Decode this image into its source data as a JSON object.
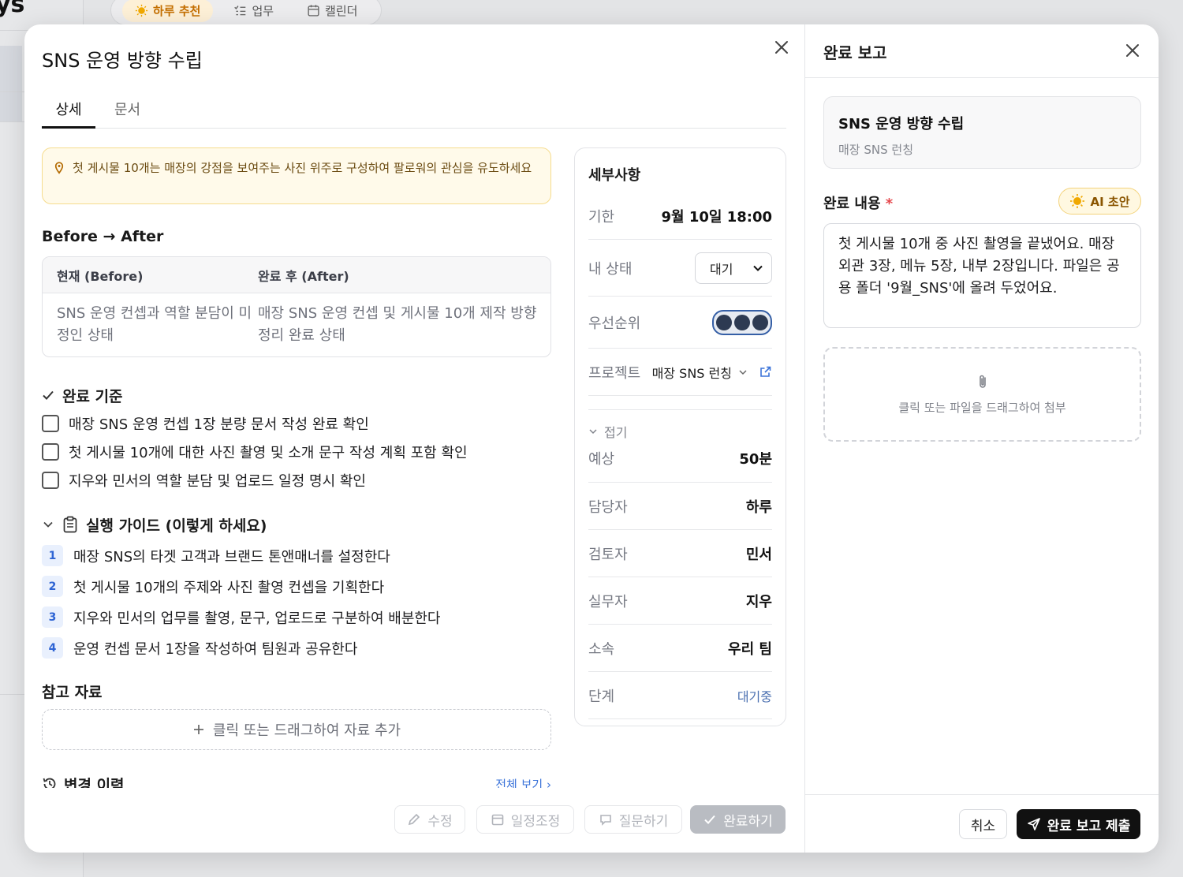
{
  "background": {
    "logo": "ys",
    "nav_tabs": [
      {
        "label": "하루 추천",
        "icon": "sun-icon",
        "active": true
      },
      {
        "label": "업무",
        "icon": "list-icon",
        "active": false
      },
      {
        "label": "캘린더",
        "icon": "calendar-icon",
        "active": false
      }
    ]
  },
  "task": {
    "title": "SNS 운영 방향 수립",
    "tabs": [
      {
        "label": "상세",
        "active": true
      },
      {
        "label": "문서",
        "active": false
      }
    ],
    "tip": "첫 게시물 10개는 매장의 강점을 보여주는 사진 위주로 구성하여 팔로워의 관심을 유도하세요",
    "before_after": {
      "heading": "Before → After",
      "before_header": "현재 (Before)",
      "after_header": "완료 후 (After)",
      "before_text": "SNS 운영 컨셉과 역할 분담이 미정인 상태",
      "after_text": "매장 SNS 운영 컨셉 및 게시물 10개 제작 방향 정리 완료 상태"
    },
    "criteria": {
      "heading": "완료 기준",
      "items": [
        "매장 SNS 운영 컨셉 1장 분량 문서 작성 완료 확인",
        "첫 게시물 10개에 대한 사진 촬영 및 소개 문구 작성 계획 포함 확인",
        "지우와 민서의 역할 분담 및 업로드 일정 명시 확인"
      ]
    },
    "guide": {
      "heading": "실행 가이드 (이렇게 하세요)",
      "steps": [
        {
          "num": "1",
          "text": "매장 SNS의 타겟 고객과 브랜드 톤앤매너를 설정한다"
        },
        {
          "num": "2",
          "text": "첫 게시물 10개의 주제와 사진 촬영 컨셉을 기획한다"
        },
        {
          "num": "3",
          "text": "지우와 민서의 업무를 촬영, 문구, 업로드로 구분하여 배분한다"
        },
        {
          "num": "4",
          "text": "운영 컨셉 문서 1장을 작성하여 팀원과 공유한다"
        }
      ]
    },
    "references": {
      "heading": "참고 자료",
      "add_label": "클릭 또는 드래그하여 자료 추가"
    },
    "history": {
      "heading": "변경 이력",
      "view_all": "전체 보기 ›"
    },
    "details": {
      "heading": "세부사항",
      "deadline_label": "기한",
      "deadline_value": "9월 10일 18:00",
      "status_label": "내 상태",
      "status_value": "대기",
      "priority_label": "우선순위",
      "priority_level": 3,
      "project_label": "프로젝트",
      "project_value": "매장 SNS 런칭",
      "collapse_label": "접기",
      "estimate_label": "예상",
      "estimate_value": "50분",
      "owner_label": "담당자",
      "owner_value": "하루",
      "reviewer_label": "검토자",
      "reviewer_value": "민서",
      "worker_label": "실무자",
      "worker_value": "지우",
      "team_label": "소속",
      "team_value": "우리 팀",
      "stage_label": "단계",
      "stage_value": "대기중"
    },
    "actions": {
      "edit": "수정",
      "reschedule": "일정조정",
      "ask": "질문하기",
      "complete": "완료하기"
    }
  },
  "report": {
    "title": "완료 보고",
    "task_title": "SNS 운영 방향 수립",
    "task_project": "매장 SNS 런칭",
    "content_label": "완료 내용",
    "required_mark": "*",
    "ai_draft_label": "AI 초안",
    "content_text": "첫 게시물 10개 중 사진 촬영을 끝냈어요. 매장 외관 3장, 메뉴 5장, 내부 2장입니다. 파일은 공용 폴더 '9월_SNS'에 올려 두었어요.",
    "attach_label": "클릭 또는 파일을 드래그하여 첨부",
    "cancel": "취소",
    "submit": "완료 보고 제출"
  },
  "colors": {
    "accent_orange": "#c46f00",
    "tip_bg": "#fffaea",
    "step_blue": "#2e64d4",
    "link_blue": "#3b73d9",
    "submit_black": "#111111",
    "required_red": "#e5484d"
  }
}
